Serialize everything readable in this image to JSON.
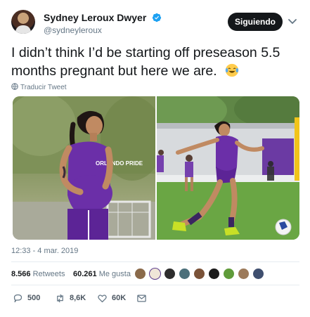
{
  "header": {
    "display_name": "Sydney Leroux Dwyer",
    "handle": "@sydneyleroux",
    "follow_label": "Siguiendo"
  },
  "tweet": {
    "text": "I didn’t think I’d be starting off preseason 5.5 months pregnant but here we are.",
    "emoji": "laughing-crying-emoji",
    "translate_label": "Traducir Tweet"
  },
  "photo_text": {
    "jersey_text": "ORLANDO PRIDE"
  },
  "timestamp": "12:33 - 4 mar. 2019",
  "stats": {
    "retweets_count": "8.566",
    "retweets_label": "Retweets",
    "likes_count": "60.261",
    "likes_label": "Me gusta"
  },
  "actions": {
    "reply_count": "500",
    "retweet_count": "8,6K",
    "like_count": "60K"
  },
  "colors": {
    "text": "#14171a",
    "secondary": "#657786",
    "verified_blue": "#1da1f2",
    "jersey_purple": "#6b2fa8",
    "button_bg": "#14171a"
  }
}
